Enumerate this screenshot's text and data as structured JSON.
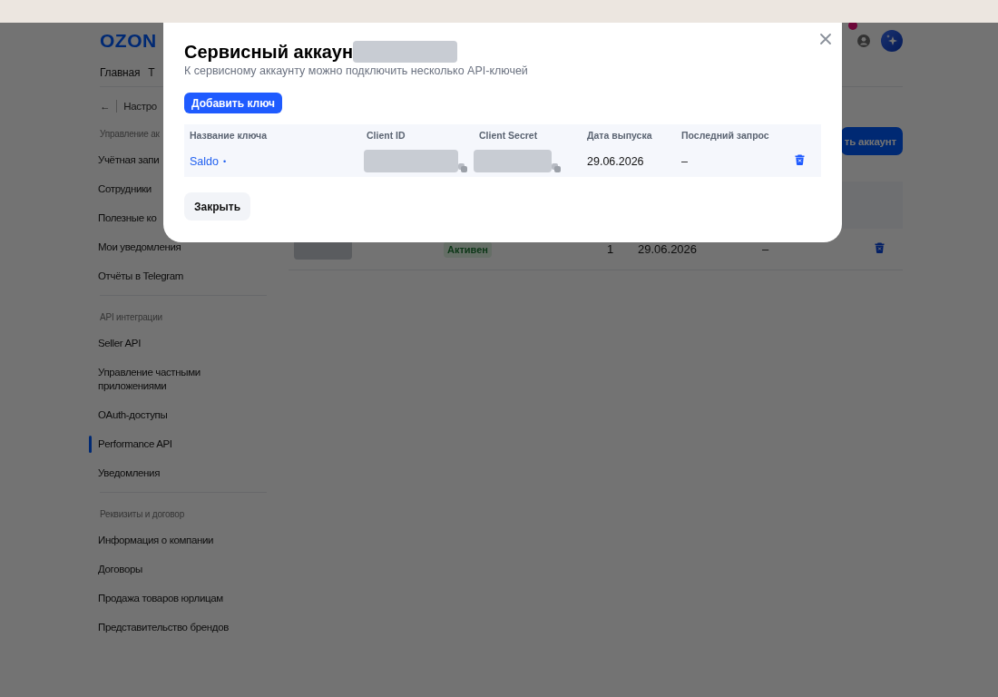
{
  "page": {
    "logo": "OZON",
    "header": {
      "notification_dot": true
    },
    "nav": [
      "Главная",
      "Т"
    ],
    "breadcrumb": {
      "back": "←",
      "current": "Настро"
    },
    "sidebar": {
      "sections": [
        {
          "title": "Управление ак",
          "items": [
            {
              "label": "Учётная запи",
              "selected": false
            },
            {
              "label": "Сотрудники",
              "selected": false
            },
            {
              "label": "Полезные ко",
              "selected": false
            },
            {
              "label": "Мои уведомления",
              "selected": false
            },
            {
              "label": "Отчёты в Telegram",
              "selected": false
            }
          ]
        },
        {
          "title": "API интеграции",
          "items": [
            {
              "label": "Seller API",
              "selected": false
            },
            {
              "label": "Управление частными приложениями",
              "selected": false
            },
            {
              "label": "OAuth-доступы",
              "selected": false
            },
            {
              "label": "Performance API",
              "selected": true
            },
            {
              "label": "Уведомления",
              "selected": false
            }
          ]
        },
        {
          "title": "Реквизиты и договор",
          "items": [
            {
              "label": "Информация о компании",
              "selected": false
            },
            {
              "label": "Договоры",
              "selected": false
            },
            {
              "label": "Продажа товаров юрлицам",
              "selected": false
            },
            {
              "label": "Представительство брендов",
              "selected": false
            }
          ]
        }
      ]
    },
    "main": {
      "primary_button": "ть аккаунт",
      "table": {
        "rows": [
          {
            "status": "Активен",
            "count": "1",
            "date": "29.06.2026",
            "last_request": "–"
          }
        ]
      }
    }
  },
  "modal": {
    "title": "Сервисный аккаун",
    "subtitle": "К сервисному аккаунту можно подключить несколько API-ключей",
    "add_button": "Добавить ключ",
    "table": {
      "columns": [
        "Название ключа",
        "Client ID",
        "Client Secret",
        "Дата выпуска",
        "Последний запрос"
      ],
      "rows": [
        {
          "name": "Saldo",
          "marker": "•",
          "issued": "29.06.2026",
          "last_request": "–"
        }
      ]
    },
    "close_button": "Закрыть"
  }
}
